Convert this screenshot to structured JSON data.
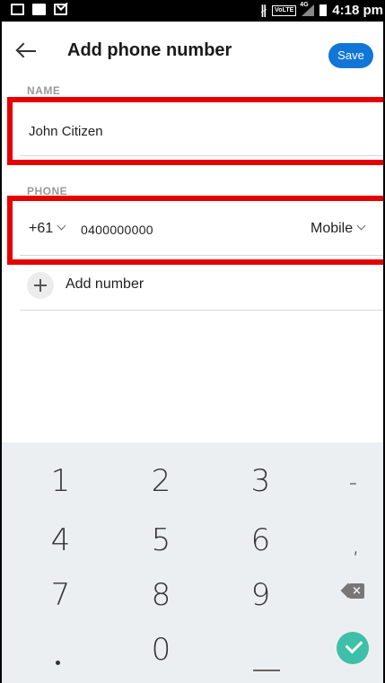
{
  "status_bar": {
    "time": "4:18 pm",
    "network": "4G",
    "volte": "VoLTE",
    "icons": [
      "gallery-icon",
      "image-icon",
      "message-icon",
      "bluetooth-icon",
      "signal-icon",
      "battery-icon"
    ]
  },
  "app_bar": {
    "title": "Add phone number",
    "save_label": "Save",
    "back_icon": "arrow-left-icon"
  },
  "form": {
    "name_label": "NAME",
    "name_value": "John Citizen",
    "phone_label": "PHONE",
    "country_code": "+61",
    "phone_number": "0400000000",
    "phone_type": "Mobile",
    "add_number_label": "Add number"
  },
  "keypad": {
    "keys": [
      "1",
      "2",
      "3",
      "-",
      "4",
      "5",
      "6",
      ",",
      "7",
      "8",
      "9",
      "",
      ".",
      "0",
      "_",
      ""
    ]
  },
  "colors": {
    "accent": "#1176d8",
    "highlight": "#e60000",
    "done": "#3dbfa8",
    "keypad_bg": "#eceff1"
  }
}
